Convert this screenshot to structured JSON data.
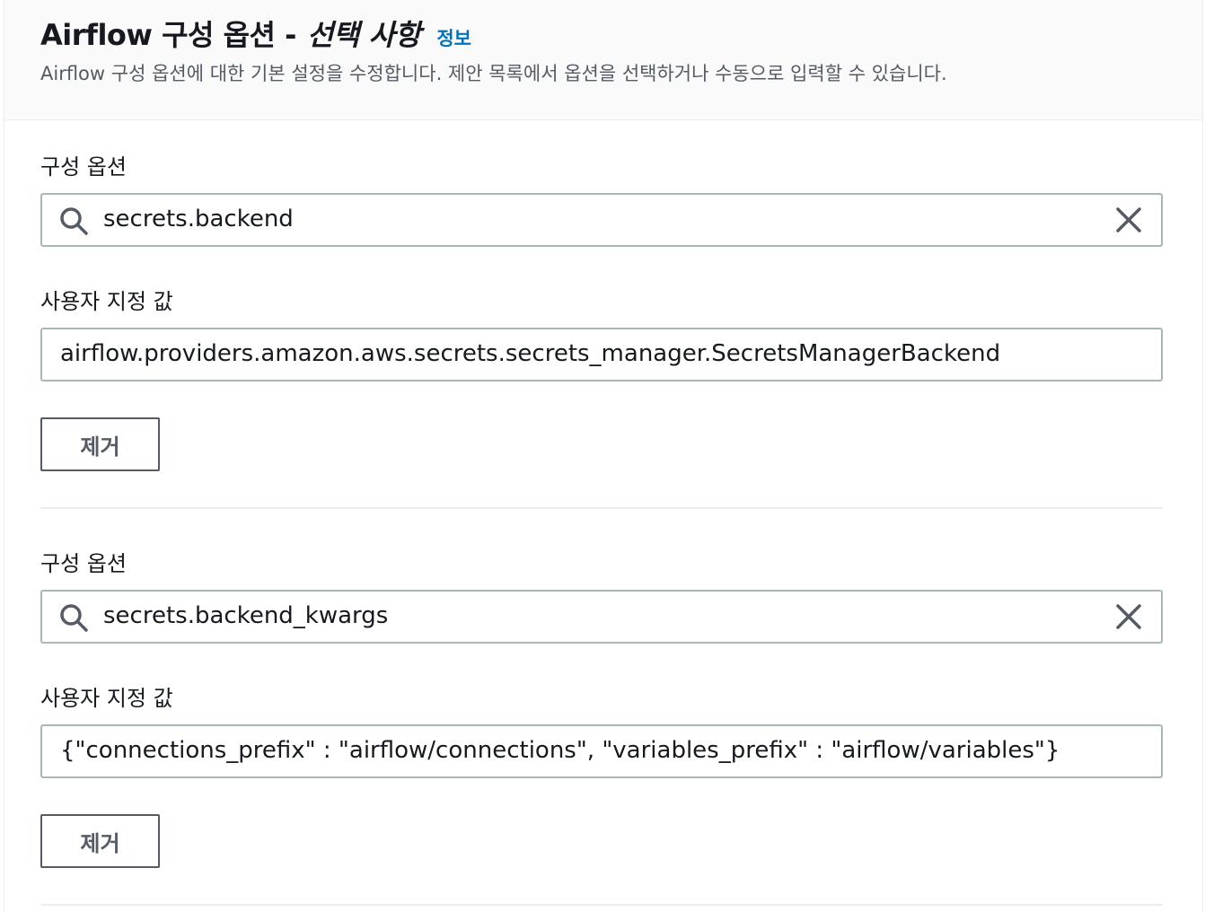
{
  "header": {
    "title_main": "Airflow 구성 옵션 -",
    "title_emphasis": "선택 사항",
    "info_link": "정보",
    "description": "Airflow 구성 옵션에 대한 기본 설정을 수정합니다. 제안 목록에서 옵션을 선택하거나 수동으로 입력할 수 있습니다."
  },
  "options": [
    {
      "option_label": "구성 옵션",
      "option_value": "secrets.backend",
      "custom_label": "사용자 지정 값",
      "custom_value": "airflow.providers.amazon.aws.secrets.secrets_manager.SecretsManagerBackend",
      "remove_label": "제거"
    },
    {
      "option_label": "구성 옵션",
      "option_value": "secrets.backend_kwargs",
      "custom_label": "사용자 지정 값",
      "custom_value": "{\"connections_prefix\" : \"airflow/connections\", \"variables_prefix\" : \"airflow/variables\"}",
      "remove_label": "제거"
    }
  ],
  "icons": {
    "search": "search-icon",
    "clear": "close-icon"
  },
  "colors": {
    "link": "#0073bb",
    "input_border": "#aab7b8",
    "button_border": "#545b64"
  }
}
